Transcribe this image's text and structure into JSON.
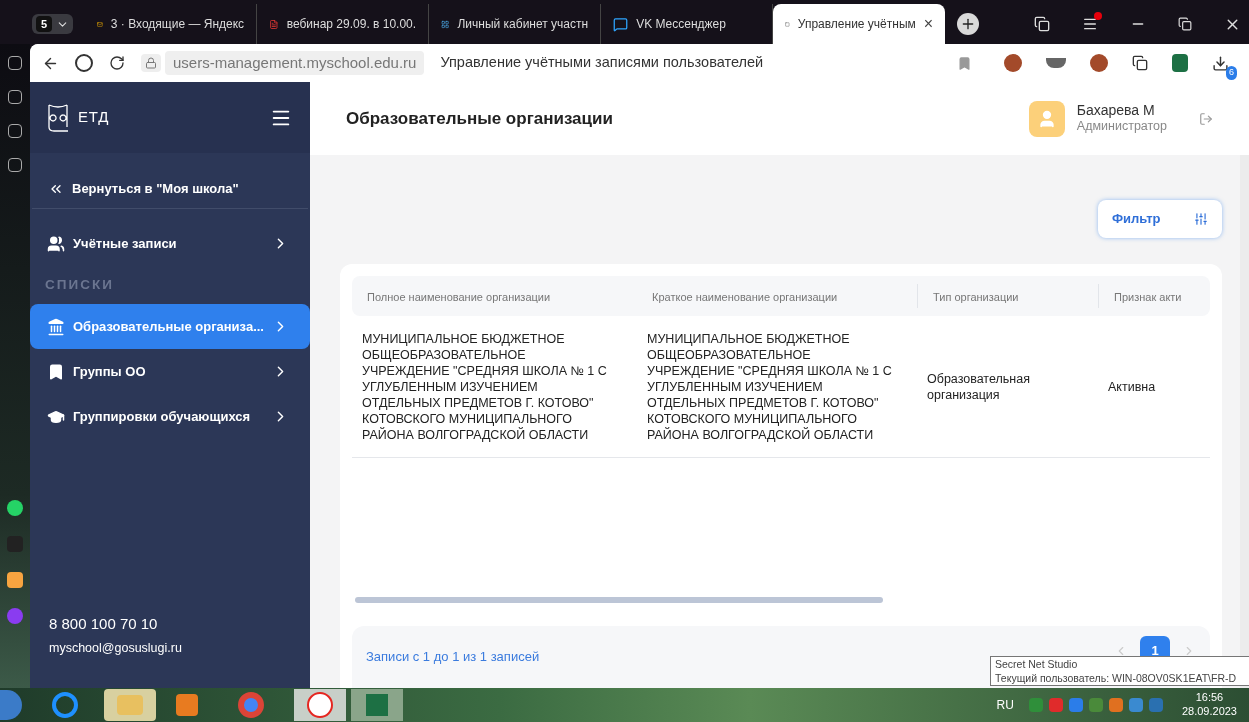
{
  "browser": {
    "tab_counter": "5",
    "tabs": [
      {
        "title": "3 · Входящие — Яндекс",
        "selected": false
      },
      {
        "title": "вебинар 29.09. в 10.00.",
        "selected": false
      },
      {
        "title": "Личный кабинет участн",
        "selected": false
      },
      {
        "title": "VK Мессенджер",
        "selected": false
      },
      {
        "title": "Управление учётным",
        "selected": true
      }
    ],
    "close_tab": "×",
    "address": {
      "url": "users-management.myschool.edu.ru",
      "page_title": "Управление учётными записями пользователей"
    },
    "download_badge": "6"
  },
  "sidebar": {
    "logo": "ЕТД",
    "back_link": "Вернуться в \"Моя школа\"",
    "nav": [
      {
        "kind": "item",
        "label": "Учётные записи",
        "selected": false
      },
      {
        "kind": "heading",
        "label": "СПИСКИ"
      },
      {
        "kind": "item",
        "label": "Образовательные организа...",
        "selected": true
      },
      {
        "kind": "item",
        "label": "Группы ОО",
        "selected": false
      },
      {
        "kind": "item",
        "label": "Группировки обучающихся",
        "selected": false
      }
    ],
    "phone": "8 800 100 70 10",
    "email": "myschool@gosuslugi.ru"
  },
  "main": {
    "title": "Образовательные организации",
    "user": {
      "name": "Бахарева М",
      "role": "Администратор"
    },
    "filter_button": "Фильтр",
    "table": {
      "columns": [
        "Полное наименование организации",
        "Краткое наименование организации",
        "Тип организации",
        "Признак акти"
      ],
      "rows": [
        {
          "cells": [
            "МУНИЦИПАЛЬНОЕ БЮДЖЕТНОЕ ОБЩЕОБРАЗОВАТЕЛЬНОЕ УЧРЕЖДЕНИЕ \"СРЕДНЯЯ ШКОЛА № 1 С УГЛУБЛЕННЫМ ИЗУЧЕНИЕМ ОТДЕЛЬНЫХ ПРЕДМЕТОВ Г. КОТОВО\" КОТОВСКОГО МУНИЦИПАЛЬНОГО РАЙОНА ВОЛГОГРАДСКОЙ ОБЛАСТИ",
            "МУНИЦИПАЛЬНОЕ БЮДЖЕТНОЕ ОБЩЕОБРАЗОВАТЕЛЬНОЕ УЧРЕЖДЕНИЕ \"СРЕДНЯЯ ШКОЛА № 1 С УГЛУБЛЕННЫМ ИЗУЧЕНИЕМ ОТДЕЛЬНЫХ ПРЕДМЕТОВ Г. КОТОВО\" КОТОВСКОГО МУНИЦИПАЛЬНОГО РАЙОНА ВОЛГОГРАДСКОЙ ОБЛАСТИ",
            "Образовательная организация",
            "Активна"
          ]
        }
      ]
    },
    "records_info": "Записи с 1 до 1 из 1 записей",
    "pages": [
      {
        "label": "1",
        "selected": true
      }
    ]
  },
  "taskbar": {
    "language": "RU",
    "time": "16:56",
    "date": "28.09.2023"
  },
  "tooltip": {
    "title": "Secret Net Studio",
    "text": "Текущий пользователь: WIN-08OV0SK1EAT\\FR-D"
  }
}
